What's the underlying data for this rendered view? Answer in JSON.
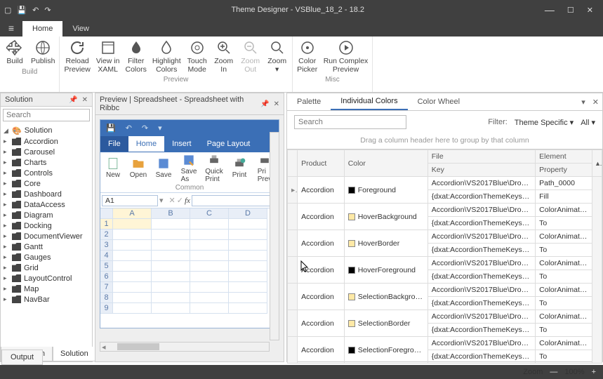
{
  "window": {
    "title": "Theme Designer  -  VSBlue_18_2 - 18.2"
  },
  "tabs": {
    "home": "Home",
    "view": "View"
  },
  "ribbon": {
    "build": {
      "build": "Build",
      "publish": "Publish",
      "label": "Build"
    },
    "preview": {
      "reload": "Reload\nPreview",
      "xaml": "View in\nXAML",
      "filterColors": "Filter\nColors",
      "highlight": "Highlight\nColors",
      "touch": "Touch\nMode",
      "zoomIn": "Zoom\nIn",
      "zoomOut": "Zoom\nOut",
      "zoom": "Zoom",
      "label": "Preview"
    },
    "misc": {
      "picker": "Color\nPicker",
      "complex": "Run Complex\nPreview",
      "label": "Misc"
    }
  },
  "solution": {
    "title": "Solution",
    "search": "Search",
    "root": "Solution",
    "items": [
      "Accordion",
      "Carousel",
      "Charts",
      "Controls",
      "Core",
      "Dashboard",
      "DataAccess",
      "Diagram",
      "Docking",
      "DocumentViewer",
      "Gantt",
      "Gauges",
      "Grid",
      "LayoutControl",
      "Map",
      "NavBar"
    ],
    "bottom": {
      "nav": "Navigation",
      "sol": "Solution"
    }
  },
  "output": {
    "tab": "Output"
  },
  "preview": {
    "title": "Preview | Spreadsheet - Spreadsheet with Ribbc",
    "ss": {
      "tabs": {
        "file": "File",
        "home": "Home",
        "insert": "Insert",
        "layout": "Page Layout"
      },
      "btns": {
        "new": "New",
        "open": "Open",
        "save": "Save",
        "saveAs": "Save\nAs",
        "quick": "Quick\nPrint",
        "print": "Print",
        "prev": "Pri\nPrev"
      },
      "group": "Common",
      "cellRef": "A1",
      "cols": [
        "A",
        "B",
        "C",
        "D"
      ],
      "rows": [
        "1",
        "2",
        "3",
        "4",
        "5",
        "6",
        "7",
        "8",
        "9"
      ]
    }
  },
  "colors": {
    "tabs": {
      "palette": "Palette",
      "individual": "Individual Colors",
      "wheel": "Color Wheel"
    },
    "search": "Search",
    "filterLbl": "Filter:",
    "filter1": "Theme Specific",
    "filter2": "All",
    "groupHint": "Drag a column header here to group by that column",
    "headers": {
      "product": "Product",
      "color": "Color",
      "file": "File",
      "key": "Key",
      "element": "Element",
      "property": "Property"
    },
    "rows": [
      {
        "prod": "Accordion",
        "sw": "#000000",
        "color": "Foreground",
        "file": "Accordion\\VS2017Blue\\DropD…",
        "key": "{dxat:AccordionThemeKeys Re…",
        "elem": "Path_0000",
        "prop": "Fill"
      },
      {
        "prod": "Accordion",
        "sw": "#ffe9a6",
        "color": "HoverBackground",
        "file": "Accordion\\VS2017Blue\\DropD…",
        "key": "{dxat:AccordionThemeKeys Re…",
        "elem": "ColorAnimatio…",
        "prop": "To"
      },
      {
        "prod": "Accordion",
        "sw": "#ffe9a6",
        "color": "HoverBorder",
        "file": "Accordion\\VS2017Blue\\DropD…",
        "key": "{dxat:AccordionThemeKeys Re…",
        "elem": "ColorAnimatio…",
        "prop": "To"
      },
      {
        "prod": "Accordion",
        "sw": "#000000",
        "color": "HoverForeground",
        "file": "Accordion\\VS2017Blue\\DropD…",
        "key": "{dxat:AccordionThemeKeys Re…",
        "elem": "ColorAnimatio…",
        "prop": "To"
      },
      {
        "prod": "Accordion",
        "sw": "#ffe9a6",
        "color": "SelectionBackground",
        "file": "Accordion\\VS2017Blue\\DropD…",
        "key": "{dxat:AccordionThemeKeys Re…",
        "elem": "ColorAnimatio…",
        "prop": "To"
      },
      {
        "prod": "Accordion",
        "sw": "#ffe9a6",
        "color": "SelectionBorder",
        "file": "Accordion\\VS2017Blue\\DropD…",
        "key": "{dxat:AccordionThemeKeys Re…",
        "elem": "ColorAnimatio…",
        "prop": "To"
      },
      {
        "prod": "Accordion",
        "sw": "#000000",
        "color": "SelectionForeground",
        "file": "Accordion\\VS2017Blue\\DropD…",
        "key": "{dxat:AccordionThemeKeys Re…",
        "elem": "ColorAnimatio…",
        "prop": "To"
      }
    ]
  },
  "status": {
    "zoom": "Zoom",
    "pct": "100%"
  }
}
